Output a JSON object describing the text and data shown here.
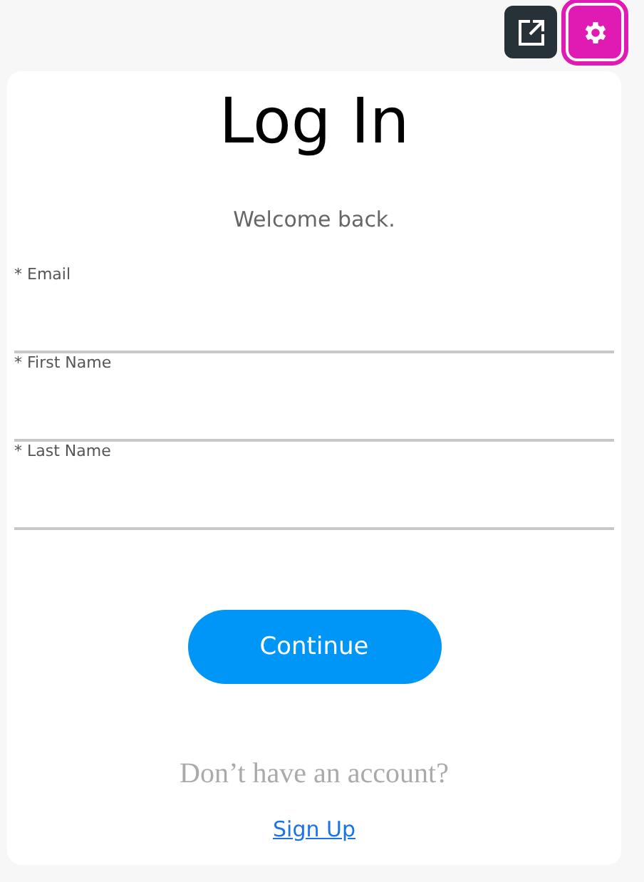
{
  "toolbar": {
    "buttons": [
      {
        "kind": "open-external",
        "selected": false
      },
      {
        "kind": "settings",
        "selected": true
      }
    ]
  },
  "title": "Log In",
  "subtitle": "Welcome back.",
  "fields": [
    {
      "label": "* Email"
    },
    {
      "label": "* First Name"
    },
    {
      "label": "* Last Name"
    }
  ],
  "submit": "Continue",
  "signup_prompt": "Don’t have an account?",
  "signup_link": "Sign Up"
}
